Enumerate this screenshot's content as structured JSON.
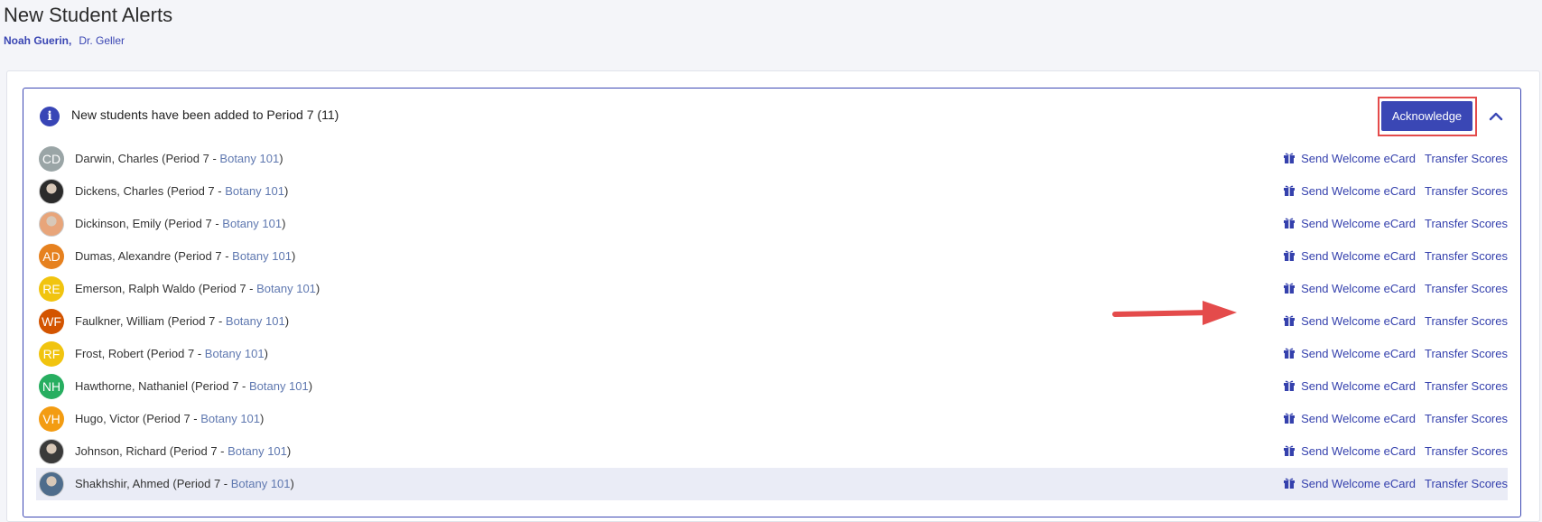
{
  "page": {
    "title": "New Student Alerts",
    "teacher": "Noah Guerin,",
    "instructor": "Dr. Geller"
  },
  "alert": {
    "message": "New students have been added to Period 7 (11)",
    "acknowledge_label": "Acknowledge",
    "info_icon": "info-circle-icon",
    "collapse_icon": "chevron-up-icon"
  },
  "actions": {
    "send_ecard": "Send Welcome eCard",
    "transfer_scores": "Transfer Scores"
  },
  "students": [
    {
      "name": "Darwin, Charles",
      "period": "(Period 7 - ",
      "course": "Botany 101",
      "close": ")",
      "initials": "CD",
      "color": "#9aa5a6",
      "photo": false
    },
    {
      "name": "Dickens, Charles",
      "period": "(Period 7 - ",
      "course": "Botany 101",
      "close": ")",
      "initials": "",
      "color": "#2b2b2b",
      "photo": true
    },
    {
      "name": "Dickinson, Emily",
      "period": "(Period 7 - ",
      "course": "Botany 101",
      "close": ")",
      "initials": "",
      "color": "#e8a57a",
      "photo": true
    },
    {
      "name": "Dumas, Alexandre",
      "period": "(Period 7 - ",
      "course": "Botany 101",
      "close": ")",
      "initials": "AD",
      "color": "#e6811f",
      "photo": false
    },
    {
      "name": "Emerson, Ralph Waldo",
      "period": "(Period 7 - ",
      "course": "Botany 101",
      "close": ")",
      "initials": "RE",
      "color": "#f1c40f",
      "photo": false
    },
    {
      "name": "Faulkner, William",
      "period": "(Period 7 - ",
      "course": "Botany 101",
      "close": ")",
      "initials": "WF",
      "color": "#d35400",
      "photo": false
    },
    {
      "name": "Frost, Robert",
      "period": "(Period 7 - ",
      "course": "Botany 101",
      "close": ")",
      "initials": "RF",
      "color": "#f1c40f",
      "photo": false
    },
    {
      "name": "Hawthorne, Nathaniel",
      "period": "(Period 7 - ",
      "course": "Botany 101",
      "close": ")",
      "initials": "NH",
      "color": "#27ae60",
      "photo": false
    },
    {
      "name": "Hugo, Victor",
      "period": "(Period 7 - ",
      "course": "Botany 101",
      "close": ")",
      "initials": "VH",
      "color": "#f39c12",
      "photo": false
    },
    {
      "name": "Johnson, Richard",
      "period": "(Period 7 - ",
      "course": "Botany 101",
      "close": ")",
      "initials": "",
      "color": "#3a3a3a",
      "photo": true
    },
    {
      "name": "Shakhshir, Ahmed",
      "period": "(Period 7 - ",
      "course": "Botany 101",
      "close": ")",
      "initials": "",
      "color": "#4f6d8c",
      "photo": true,
      "highlighted": true
    }
  ],
  "annotation": {
    "arrow_color": "#e44b4b",
    "frame_color": "#e44b4b"
  }
}
